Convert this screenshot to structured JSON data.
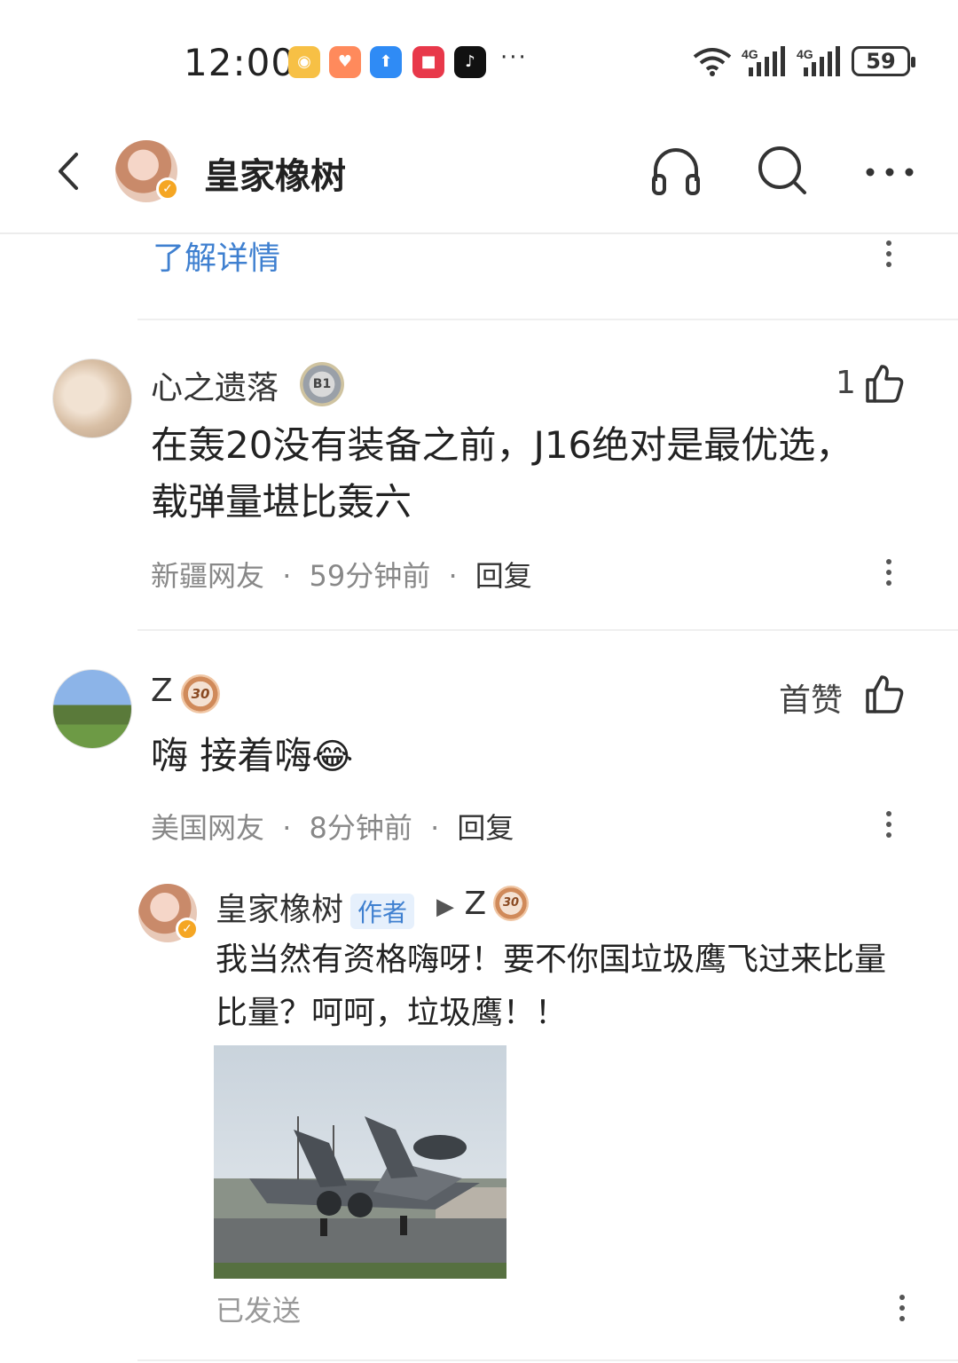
{
  "status_bar": {
    "time": "12:00",
    "more": "···",
    "network_1": "4G",
    "network_2": "4G",
    "battery": "59",
    "app_icons": [
      "weibo-icon",
      "health-icon",
      "upload-icon",
      "huawei-appgallery-icon",
      "tiktok-icon"
    ]
  },
  "header": {
    "title": "皇家橡树",
    "icons": [
      "back-icon",
      "headphones-icon",
      "search-icon",
      "more-icon"
    ]
  },
  "section": {
    "link": "了解详情"
  },
  "comments": [
    {
      "username": "心之遗落",
      "badge_text": "B1",
      "likes": "1",
      "text": "在轰20没有装备之前，J16绝对是最优选，载弹量堪比轰六",
      "location": "新疆网友",
      "time": "59分钟前",
      "reply": "回复"
    },
    {
      "username": "Z",
      "badge_text": "30",
      "likes": "首赞",
      "text": "嗨 接着嗨",
      "emoji": "😂",
      "location": "美国网友",
      "time": "8分钟前",
      "reply": "回复",
      "replies": [
        {
          "username": "皇家橡树",
          "tag": "作者",
          "arrow": "▶",
          "target": "Z",
          "target_badge": "30",
          "text": "我当然有资格嗨呀！要不你国垃圾鹰飞过来比量比量？呵呵，垃圾鹰！！",
          "image": "fighter-jet-photo",
          "status": "已发送"
        }
      ]
    }
  ],
  "separator": "·"
}
